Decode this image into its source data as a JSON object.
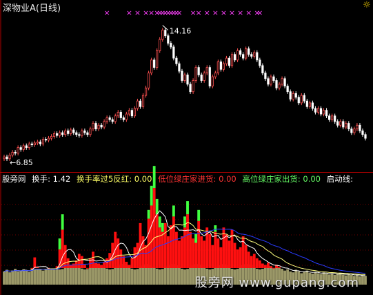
{
  "header": {
    "title": "深物业A(日线)"
  },
  "indicator_line": {
    "name": "股旁网",
    "items": [
      {
        "label": "换手: 1.42",
        "color": "#ffffff"
      },
      {
        "label": "换手率过5反红: 0.00",
        "color": "#ffff66"
      },
      {
        "label": "低位绿庄家进货: 0.00",
        "color": "#ff3333"
      },
      {
        "label": "高位绿庄家出货: 0.00",
        "color": "#66ff66"
      },
      {
        "label": "启动线:",
        "color": "#ffffff"
      }
    ]
  },
  "watermark": "股旁网 www.gupang.com",
  "colors": {
    "up": "#ff5050",
    "down": "#ffffff",
    "axis": "#b00000",
    "mark": "#ff40ff",
    "vol_red": "#ff1010",
    "vol_green": "#40ff40",
    "vol_base": "#9b9868",
    "ma_white": "#ffffff",
    "ma_blue": "#2a3cff",
    "ma_yellow": "#ffff80"
  },
  "chart_data": [
    {
      "type": "candlestick",
      "annotations": [
        {
          "text": "14.16",
          "index": 57,
          "value": 14.16
        },
        {
          "text": "6.85",
          "index": 2,
          "value": 6.85
        }
      ],
      "close": [
        7.1,
        7.0,
        7.2,
        7.35,
        7.3,
        7.6,
        7.5,
        7.7,
        7.6,
        7.8,
        7.75,
        7.85,
        7.9,
        7.8,
        8.05,
        8.0,
        8.1,
        8.2,
        8.35,
        8.25,
        8.4,
        8.3,
        8.5,
        8.35,
        8.55,
        8.4,
        8.3,
        8.25,
        8.5,
        8.4,
        8.3,
        8.6,
        8.9,
        8.6,
        8.8,
        8.7,
        9.0,
        9.2,
        9.1,
        9.0,
        9.3,
        9.5,
        9.2,
        9.1,
        9.4,
        9.6,
        9.3,
        9.7,
        10.1,
        9.8,
        10.4,
        10.8,
        11.6,
        12.3,
        11.9,
        12.8,
        13.4,
        13.9,
        13.6,
        13.2,
        13.0,
        12.4,
        12.1,
        11.7,
        11.2,
        11.5,
        11.0,
        10.6,
        11.2,
        11.9,
        11.5,
        11.2,
        11.6,
        11.9,
        10.9,
        11.4,
        11.6,
        12.2,
        11.8,
        12.1,
        12.4,
        12.0,
        12.6,
        12.3,
        12.8,
        12.6,
        12.4,
        12.9,
        12.6,
        12.5,
        12.7,
        12.3,
        12.0,
        11.6,
        11.3,
        11.0,
        11.4,
        11.2,
        10.8,
        11.0,
        11.3,
        10.9,
        10.6,
        10.2,
        10.5,
        10.3,
        10.0,
        10.4,
        10.1,
        9.8,
        10.0,
        9.7,
        9.5,
        9.7,
        9.4,
        9.6,
        9.3,
        9.1,
        9.3,
        9.0,
        8.8,
        9.0,
        8.7,
        8.9,
        8.6,
        8.4,
        8.6,
        8.8,
        8.5,
        8.3,
        8.1
      ],
      "volume": [
        3.0,
        3.4,
        2.8,
        3.2,
        3.6,
        3.0,
        3.1,
        3.5,
        3.2,
        2.9,
        3.8,
        6.2,
        4.0,
        3.5,
        3.2,
        3.6,
        3.8,
        3.5,
        3.4,
        4.2,
        8.0,
        12.5,
        9.0,
        6.0,
        4.5,
        4.8,
        5.5,
        7.0,
        6.5,
        4.5,
        3.8,
        6.0,
        7.5,
        5.0,
        4.8,
        4.5,
        5.2,
        6.0,
        7.2,
        9.5,
        12.0,
        10.5,
        8.0,
        6.5,
        5.2,
        4.5,
        6.0,
        8.5,
        9.5,
        14.0,
        11.0,
        9.0,
        15.0,
        18.0,
        22.0,
        16.0,
        13.0,
        12.0,
        14.0,
        11.0,
        13.5,
        15.5,
        12.0,
        10.0,
        11.0,
        13.0,
        16.0,
        12.0,
        10.5,
        9.5,
        14.5,
        11.0,
        10.0,
        13.0,
        11.5,
        9.0,
        12.0,
        10.5,
        8.5,
        13.0,
        11.5,
        10.0,
        12.5,
        9.5,
        8.0,
        8.5,
        11.0,
        9.0,
        7.5,
        6.5,
        7.0,
        6.0,
        5.5,
        4.8,
        4.5,
        5.0,
        4.2,
        3.8,
        4.5,
        4.0,
        3.6,
        3.2,
        3.5,
        3.0,
        2.8,
        3.4,
        3.0,
        2.6,
        2.9,
        3.2,
        2.7,
        2.5,
        2.9,
        2.6,
        2.4,
        2.8,
        2.5,
        2.3,
        2.6,
        2.2,
        2.4,
        2.7,
        2.3,
        2.1,
        2.5,
        2.2,
        2.0,
        2.3,
        1.9,
        2.1,
        2.0
      ],
      "green_tips": [
        [
          20,
          2.5
        ],
        [
          21,
          3.5
        ],
        [
          52,
          2.0
        ],
        [
          53,
          4.5
        ],
        [
          54,
          5.0
        ],
        [
          55,
          3.5
        ],
        [
          56,
          2.5
        ],
        [
          57,
          2.0
        ],
        [
          61,
          2.5
        ],
        [
          65,
          2.5
        ],
        [
          66,
          3.0
        ],
        [
          69,
          2.0
        ],
        [
          70,
          2.5
        ],
        [
          76,
          1.5
        ]
      ],
      "signal_indices": [
        37,
        45,
        48,
        51,
        53,
        55,
        56,
        57,
        58,
        59,
        60,
        61,
        62,
        63,
        68,
        70,
        73,
        76,
        79,
        82,
        85,
        88,
        91,
        92
      ],
      "ylim": [
        6.4,
        15.0
      ],
      "vol_ylim": [
        0,
        22
      ]
    }
  ]
}
